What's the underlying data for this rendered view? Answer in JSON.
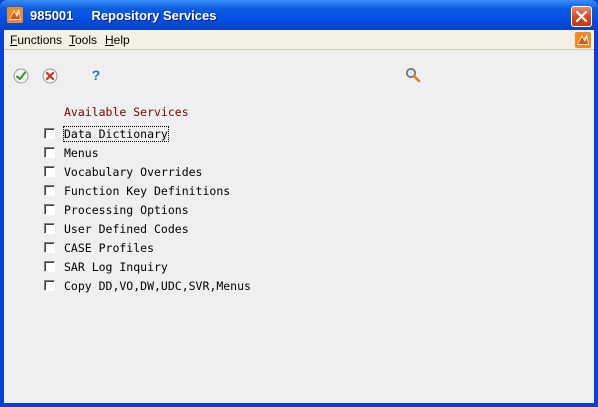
{
  "window": {
    "title": "985001     Repository Services",
    "colors": {
      "titlebar": "#0551e4",
      "client": "#efefef",
      "section_title": "#7a0000"
    }
  },
  "menubar": {
    "items": [
      {
        "label": "Functions",
        "underline": "F",
        "rest": "unctions"
      },
      {
        "label": "Tools",
        "underline": "T",
        "rest": "ools"
      },
      {
        "label": "Help",
        "underline": "H",
        "rest": "elp"
      }
    ]
  },
  "toolbar": {
    "ok_icon": "checkmark-icon",
    "cancel_icon": "x-icon",
    "help_icon": "question-icon",
    "find_icon": "magnifier-icon",
    "help_glyph": "?"
  },
  "services": {
    "title": "Available Services",
    "items": [
      {
        "label": "Data Dictionary",
        "checked": false
      },
      {
        "label": "Menus",
        "checked": false
      },
      {
        "label": "Vocabulary Overrides",
        "checked": false
      },
      {
        "label": "Function Key Definitions",
        "checked": false
      },
      {
        "label": "Processing Options",
        "checked": false
      },
      {
        "label": "User Defined Codes",
        "checked": false
      },
      {
        "label": "CASE Profiles",
        "checked": false
      },
      {
        "label": "SAR Log Inquiry",
        "checked": false
      },
      {
        "label": "Copy DD,VO,DW,UDC,SVR,Menus",
        "checked": false
      }
    ]
  }
}
